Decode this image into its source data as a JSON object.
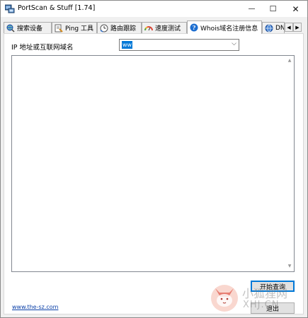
{
  "window": {
    "title": "PortScan & Stuff [1.74]",
    "controls": {
      "minimize": "—",
      "maximize": "☐",
      "close": "✕"
    }
  },
  "tabs": [
    {
      "label": "搜索设备",
      "icon": "globe-search-icon",
      "active": false
    },
    {
      "label": "Ping 工具",
      "icon": "ping-tool-icon",
      "active": false
    },
    {
      "label": "路由跟踪",
      "icon": "clock-trace-icon",
      "active": false
    },
    {
      "label": "速度测试",
      "icon": "speedometer-icon",
      "active": false
    },
    {
      "label": "Whois域名注册信息",
      "icon": "whois-info-icon",
      "active": true
    },
    {
      "label": "DN",
      "icon": "globe-icon",
      "active": false
    }
  ],
  "tab_scroll": {
    "left": "◀",
    "right": "▶"
  },
  "whois": {
    "input_label": "IP 地址或互联网域名",
    "input_value": "ww",
    "combo_arrow": "⌵",
    "result_text": "",
    "start_button": "开始查询",
    "exit_button": "退出",
    "footer_link": "www.the-sz.com"
  },
  "watermark": {
    "line1": "小狐狸网",
    "line2": "XHJ.CN"
  },
  "colors": {
    "selection": "#0078d7",
    "link": "#0b40a8",
    "watermark_red": "#e0584a"
  }
}
